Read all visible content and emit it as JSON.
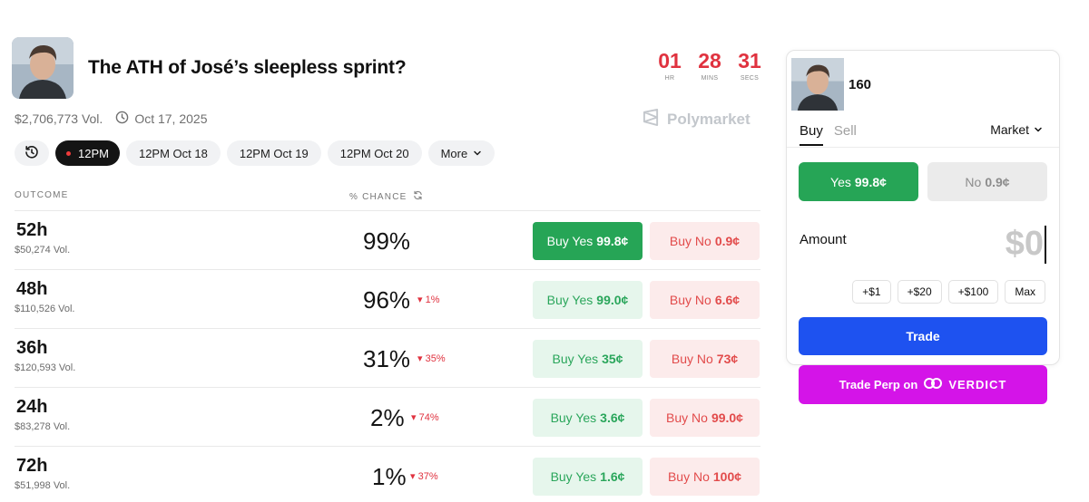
{
  "market": {
    "title": "The ATH of José’s sleepless sprint?",
    "volume": "$2,706,773 Vol.",
    "date": "Oct 17, 2025",
    "brand": "Polymarket",
    "avatar_icon": "person-photo"
  },
  "countdown": {
    "hours": "01",
    "hours_label": "HR",
    "mins": "28",
    "mins_label": "MINS",
    "secs": "31",
    "secs_label": "SECS"
  },
  "filters": {
    "current": "12PM",
    "options": [
      "12PM Oct 18",
      "12PM Oct 19",
      "12PM Oct 20"
    ],
    "more": "More"
  },
  "table": {
    "col_outcome": "OUTCOME",
    "col_chance": "% CHANCE",
    "rows": [
      {
        "name": "52h",
        "vol": "$50,274 Vol.",
        "pct": "99%",
        "change": "",
        "yes_label": "Buy Yes",
        "yes_price": "99.8¢",
        "no_label": "Buy No",
        "no_price": "0.9¢"
      },
      {
        "name": "48h",
        "vol": "$110,526 Vol.",
        "pct": "96%",
        "change": "1%",
        "yes_label": "Buy Yes",
        "yes_price": "99.0¢",
        "no_label": "Buy No",
        "no_price": "6.6¢"
      },
      {
        "name": "36h",
        "vol": "$120,593 Vol.",
        "pct": "31%",
        "change": "35%",
        "yes_label": "Buy Yes",
        "yes_price": "35¢",
        "no_label": "Buy No",
        "no_price": "73¢"
      },
      {
        "name": "24h",
        "vol": "$83,278 Vol.",
        "pct": "2%",
        "change": "74%",
        "yes_label": "Buy Yes",
        "yes_price": "3.6¢",
        "no_label": "Buy No",
        "no_price": "99.0¢"
      },
      {
        "name": "72h",
        "vol": "$51,998 Vol.",
        "pct": "1%",
        "change": "37%",
        "yes_label": "Buy Yes",
        "yes_price": "1.6¢",
        "no_label": "Buy No",
        "no_price": "100¢"
      }
    ]
  },
  "panel": {
    "outcome_name": "160",
    "tab_buy": "Buy",
    "tab_sell": "Sell",
    "order_type": "Market",
    "yes_label": "Yes",
    "yes_price": "99.8¢",
    "no_label": "No",
    "no_price": "0.9¢",
    "amount_label": "Amount",
    "amount_value": "$0",
    "quick": [
      "+$1",
      "+$20",
      "+$100",
      "Max"
    ],
    "trade": "Trade",
    "perp_prefix": "Trade Perp on",
    "perp_brand": "VERDICT"
  },
  "colors": {
    "countdown": "#e0323f",
    "yes": "#26a556",
    "no": "#e24b4b",
    "trade": "#1e52f0",
    "perp": "#d414e8"
  }
}
